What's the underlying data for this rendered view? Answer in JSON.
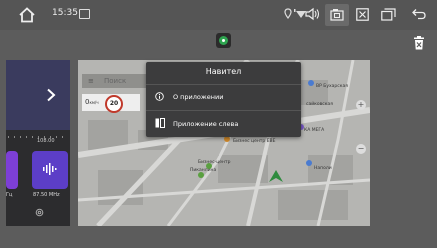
{
  "status_bar": {
    "time": "15:35",
    "icons": [
      "home-icon",
      "media-icon",
      "location-icon",
      "wifi-signal-icon",
      "volume-icon",
      "screenshot-icon",
      "close-app-icon",
      "recent-apps-icon",
      "back-icon"
    ]
  },
  "left_card": {
    "freq_top": "108.00",
    "tile_a_label": "Гц",
    "tile_b_label": "87.50 MHz"
  },
  "map": {
    "search_placeholder": "Поиск",
    "speed_current": "0",
    "speed_unit": "км/ч",
    "speed_limit": "20",
    "labels": {
      "l1": "ВР Бухарская",
      "l2": "сайковская",
      "l3": "КА МЕГА",
      "l4": "Бизнес центр ЕВЕ",
      "l5": "Бизнес-центр",
      "l6": "Пиканлина",
      "l7": "Наполи"
    }
  },
  "context_menu": {
    "title": "Навител",
    "items": [
      {
        "label": "О приложении",
        "icon": "info-icon"
      },
      {
        "label": "Приложение слева",
        "icon": "split-screen-icon"
      }
    ]
  },
  "colors": {
    "background": "#5c5c5c",
    "menu_bg": "#3c3c3d",
    "accent_purple": "#5c3ec7"
  }
}
